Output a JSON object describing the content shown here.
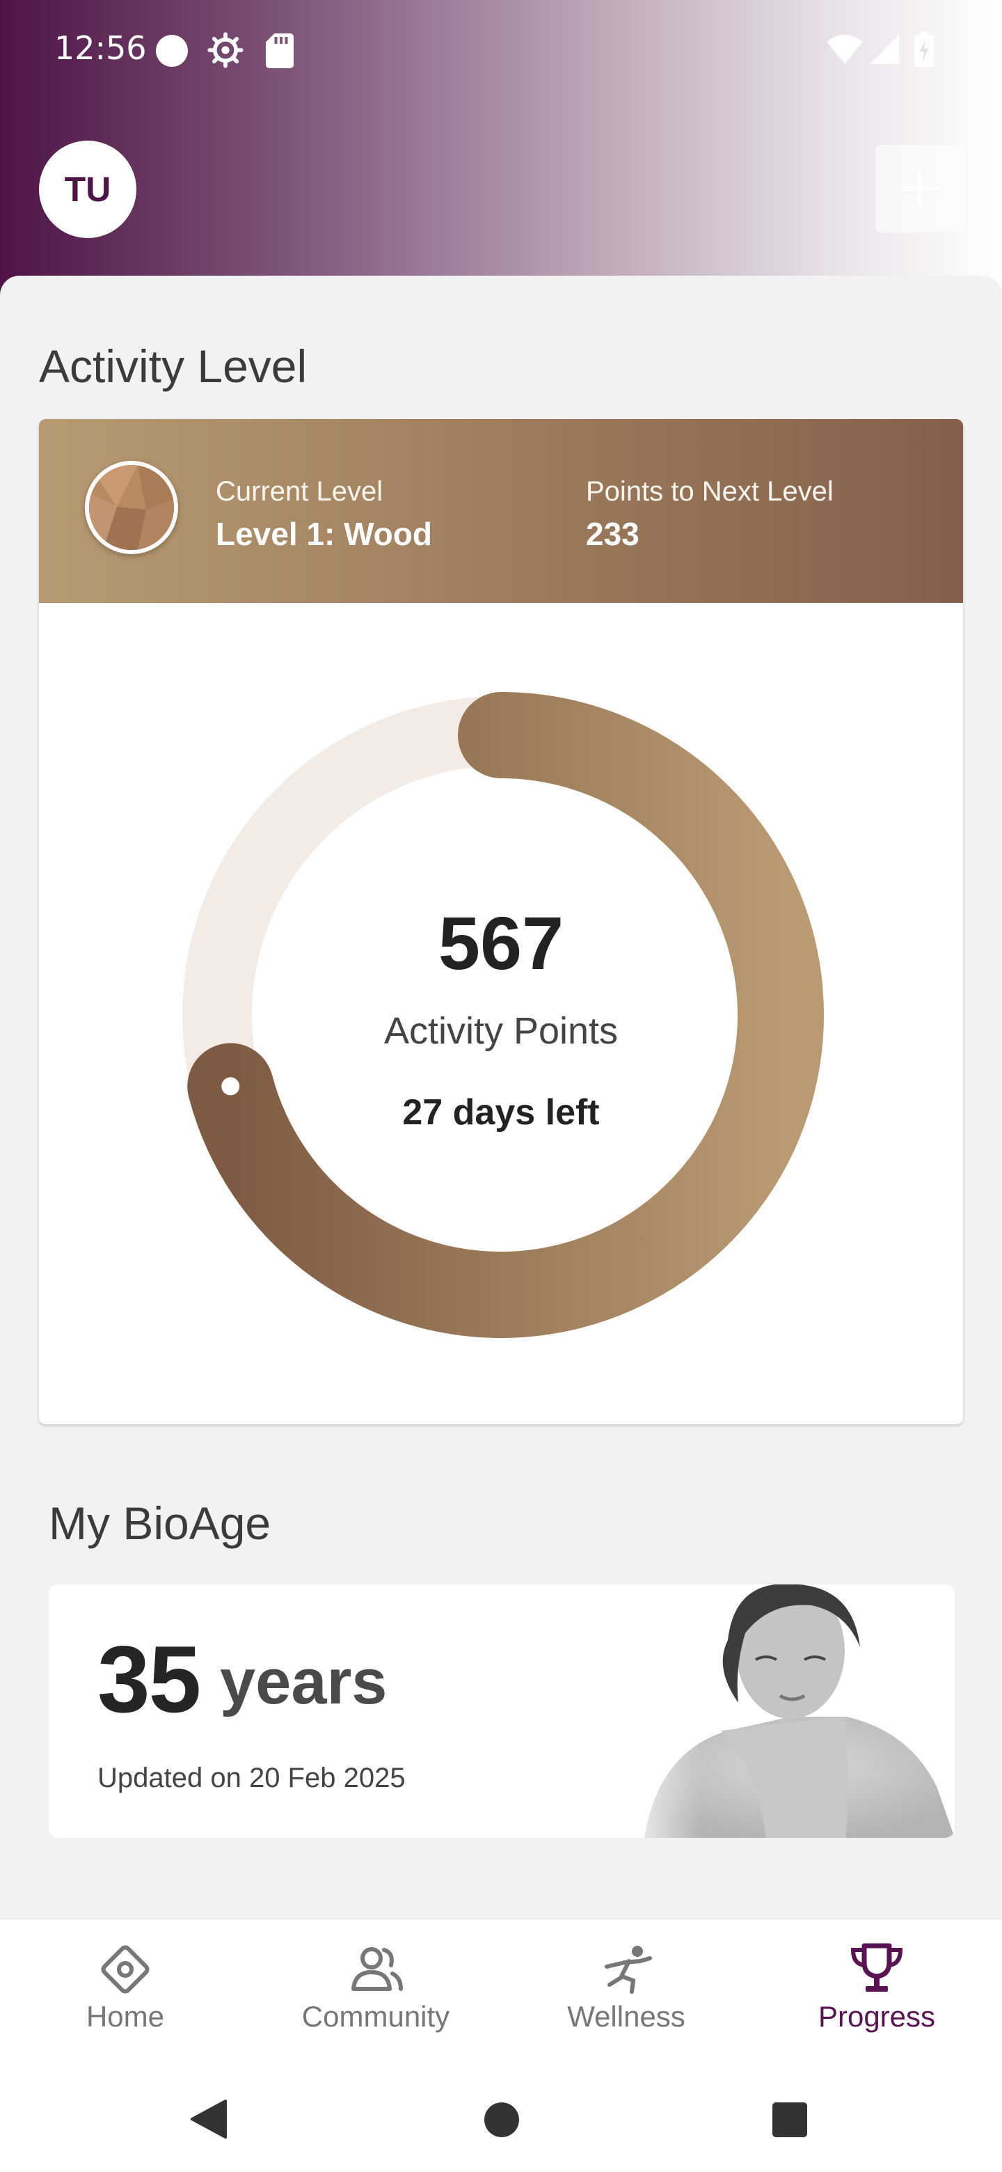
{
  "status_bar": {
    "time": "12:56",
    "icons": [
      "notification-dot-icon",
      "gear-icon",
      "sd-card-icon",
      "wifi-icon",
      "signal-icon",
      "battery-icon"
    ]
  },
  "header": {
    "avatar_initials": "TU",
    "add_icon": "plus-icon"
  },
  "activity": {
    "section_title": "Activity Level",
    "current_level_label": "Current Level",
    "current_level_value": "Level 1: Wood",
    "next_level_label": "Points to Next Level",
    "next_level_value": "233",
    "points": "567",
    "points_label": "Activity Points",
    "days_left": "27 days left",
    "progress_fraction": 0.709
  },
  "bioage": {
    "section_title": "My BioAge",
    "age_value": "35",
    "age_unit": "years",
    "updated_text": "Updated on 20 Feb 2025"
  },
  "bottom_nav": {
    "items": [
      {
        "label": "Home",
        "icon": "home-diamond-icon"
      },
      {
        "label": "Community",
        "icon": "community-people-icon"
      },
      {
        "label": "Wellness",
        "icon": "wellness-runner-icon"
      },
      {
        "label": "Progress",
        "icon": "trophy-icon"
      }
    ],
    "active": "Progress"
  },
  "colors": {
    "brand_purple": "#5a1352",
    "level_bronze_light": "#b79a72",
    "level_bronze_dark": "#7e5a42",
    "ring_track": "#f3ece6"
  }
}
